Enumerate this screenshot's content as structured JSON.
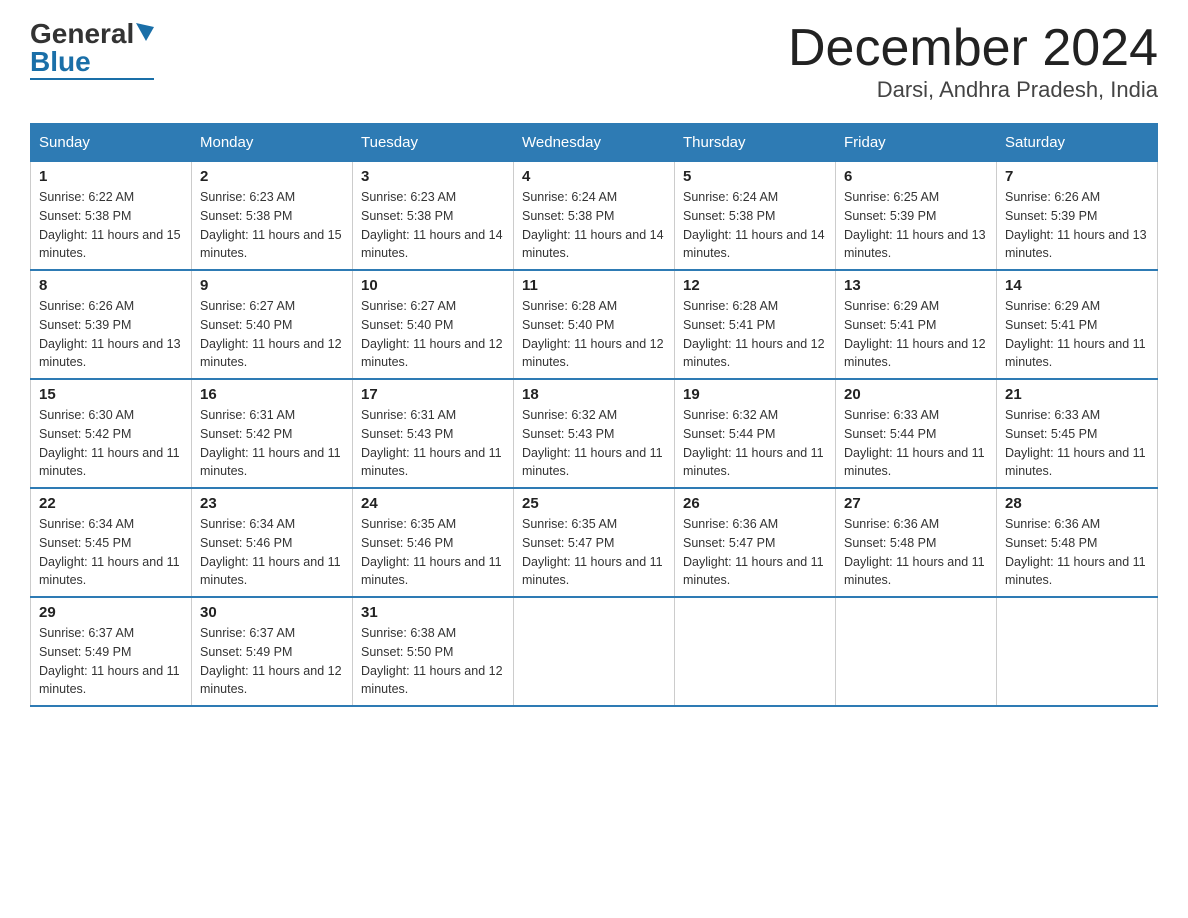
{
  "logo": {
    "general": "General",
    "blue": "Blue"
  },
  "title": "December 2024",
  "location": "Darsi, Andhra Pradesh, India",
  "headers": [
    "Sunday",
    "Monday",
    "Tuesday",
    "Wednesday",
    "Thursday",
    "Friday",
    "Saturday"
  ],
  "weeks": [
    [
      {
        "day": "1",
        "sunrise": "6:22 AM",
        "sunset": "5:38 PM",
        "daylight": "11 hours and 15 minutes."
      },
      {
        "day": "2",
        "sunrise": "6:23 AM",
        "sunset": "5:38 PM",
        "daylight": "11 hours and 15 minutes."
      },
      {
        "day": "3",
        "sunrise": "6:23 AM",
        "sunset": "5:38 PM",
        "daylight": "11 hours and 14 minutes."
      },
      {
        "day": "4",
        "sunrise": "6:24 AM",
        "sunset": "5:38 PM",
        "daylight": "11 hours and 14 minutes."
      },
      {
        "day": "5",
        "sunrise": "6:24 AM",
        "sunset": "5:38 PM",
        "daylight": "11 hours and 14 minutes."
      },
      {
        "day": "6",
        "sunrise": "6:25 AM",
        "sunset": "5:39 PM",
        "daylight": "11 hours and 13 minutes."
      },
      {
        "day": "7",
        "sunrise": "6:26 AM",
        "sunset": "5:39 PM",
        "daylight": "11 hours and 13 minutes."
      }
    ],
    [
      {
        "day": "8",
        "sunrise": "6:26 AM",
        "sunset": "5:39 PM",
        "daylight": "11 hours and 13 minutes."
      },
      {
        "day": "9",
        "sunrise": "6:27 AM",
        "sunset": "5:40 PM",
        "daylight": "11 hours and 12 minutes."
      },
      {
        "day": "10",
        "sunrise": "6:27 AM",
        "sunset": "5:40 PM",
        "daylight": "11 hours and 12 minutes."
      },
      {
        "day": "11",
        "sunrise": "6:28 AM",
        "sunset": "5:40 PM",
        "daylight": "11 hours and 12 minutes."
      },
      {
        "day": "12",
        "sunrise": "6:28 AM",
        "sunset": "5:41 PM",
        "daylight": "11 hours and 12 minutes."
      },
      {
        "day": "13",
        "sunrise": "6:29 AM",
        "sunset": "5:41 PM",
        "daylight": "11 hours and 12 minutes."
      },
      {
        "day": "14",
        "sunrise": "6:29 AM",
        "sunset": "5:41 PM",
        "daylight": "11 hours and 11 minutes."
      }
    ],
    [
      {
        "day": "15",
        "sunrise": "6:30 AM",
        "sunset": "5:42 PM",
        "daylight": "11 hours and 11 minutes."
      },
      {
        "day": "16",
        "sunrise": "6:31 AM",
        "sunset": "5:42 PM",
        "daylight": "11 hours and 11 minutes."
      },
      {
        "day": "17",
        "sunrise": "6:31 AM",
        "sunset": "5:43 PM",
        "daylight": "11 hours and 11 minutes."
      },
      {
        "day": "18",
        "sunrise": "6:32 AM",
        "sunset": "5:43 PM",
        "daylight": "11 hours and 11 minutes."
      },
      {
        "day": "19",
        "sunrise": "6:32 AM",
        "sunset": "5:44 PM",
        "daylight": "11 hours and 11 minutes."
      },
      {
        "day": "20",
        "sunrise": "6:33 AM",
        "sunset": "5:44 PM",
        "daylight": "11 hours and 11 minutes."
      },
      {
        "day": "21",
        "sunrise": "6:33 AM",
        "sunset": "5:45 PM",
        "daylight": "11 hours and 11 minutes."
      }
    ],
    [
      {
        "day": "22",
        "sunrise": "6:34 AM",
        "sunset": "5:45 PM",
        "daylight": "11 hours and 11 minutes."
      },
      {
        "day": "23",
        "sunrise": "6:34 AM",
        "sunset": "5:46 PM",
        "daylight": "11 hours and 11 minutes."
      },
      {
        "day": "24",
        "sunrise": "6:35 AM",
        "sunset": "5:46 PM",
        "daylight": "11 hours and 11 minutes."
      },
      {
        "day": "25",
        "sunrise": "6:35 AM",
        "sunset": "5:47 PM",
        "daylight": "11 hours and 11 minutes."
      },
      {
        "day": "26",
        "sunrise": "6:36 AM",
        "sunset": "5:47 PM",
        "daylight": "11 hours and 11 minutes."
      },
      {
        "day": "27",
        "sunrise": "6:36 AM",
        "sunset": "5:48 PM",
        "daylight": "11 hours and 11 minutes."
      },
      {
        "day": "28",
        "sunrise": "6:36 AM",
        "sunset": "5:48 PM",
        "daylight": "11 hours and 11 minutes."
      }
    ],
    [
      {
        "day": "29",
        "sunrise": "6:37 AM",
        "sunset": "5:49 PM",
        "daylight": "11 hours and 11 minutes."
      },
      {
        "day": "30",
        "sunrise": "6:37 AM",
        "sunset": "5:49 PM",
        "daylight": "11 hours and 12 minutes."
      },
      {
        "day": "31",
        "sunrise": "6:38 AM",
        "sunset": "5:50 PM",
        "daylight": "11 hours and 12 minutes."
      },
      null,
      null,
      null,
      null
    ]
  ]
}
